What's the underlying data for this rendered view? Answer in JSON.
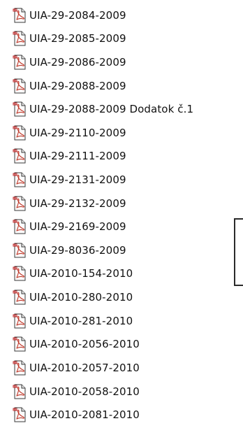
{
  "explorer": {
    "files": [
      {
        "name": "UIA-29-2084-2009",
        "icon": "pdf-file-icon"
      },
      {
        "name": "UIA-29-2085-2009",
        "icon": "pdf-file-icon"
      },
      {
        "name": "UIA-29-2086-2009",
        "icon": "pdf-file-icon"
      },
      {
        "name": "UIA-29-2088-2009",
        "icon": "pdf-file-icon"
      },
      {
        "name": "UIA-29-2088-2009 Dodatok č.1",
        "icon": "pdf-file-icon"
      },
      {
        "name": "UIA-29-2110-2009",
        "icon": "pdf-file-icon"
      },
      {
        "name": "UIA-29-2111-2009",
        "icon": "pdf-file-icon"
      },
      {
        "name": "UIA-29-2131-2009",
        "icon": "pdf-file-icon"
      },
      {
        "name": "UIA-29-2132-2009",
        "icon": "pdf-file-icon"
      },
      {
        "name": "UIA-29-2169-2009",
        "icon": "pdf-file-icon"
      },
      {
        "name": "UIA-29-8036-2009",
        "icon": "pdf-file-icon"
      },
      {
        "name": "UIA-2010-154-2010",
        "icon": "pdf-file-icon"
      },
      {
        "name": "UIA-2010-280-2010",
        "icon": "pdf-file-icon"
      },
      {
        "name": "UIA-2010-281-2010",
        "icon": "pdf-file-icon"
      },
      {
        "name": "UIA-2010-2056-2010",
        "icon": "pdf-file-icon"
      },
      {
        "name": "UIA-2010-2057-2010",
        "icon": "pdf-file-icon"
      },
      {
        "name": "UIA-2010-2058-2010",
        "icon": "pdf-file-icon"
      },
      {
        "name": "UIA-2010-2081-2010",
        "icon": "pdf-file-icon"
      }
    ]
  }
}
